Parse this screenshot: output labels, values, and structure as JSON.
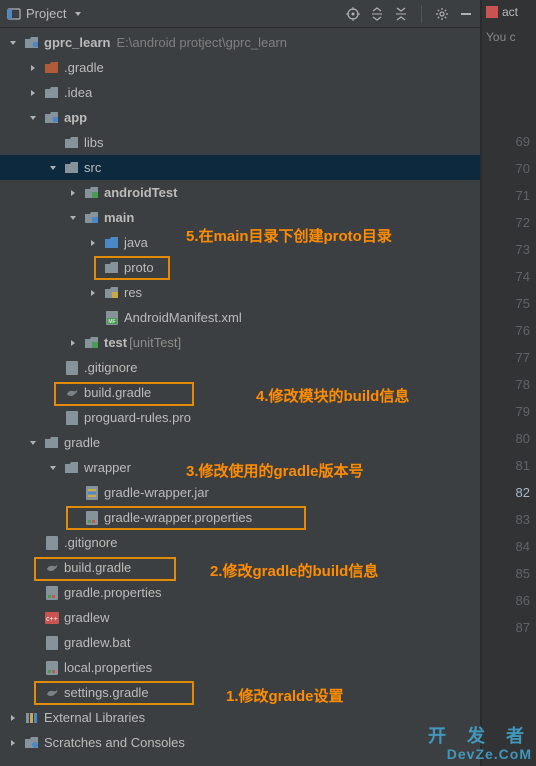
{
  "toolbar": {
    "view_label": "Project"
  },
  "right_panel": {
    "tab_label": "act",
    "hint": "You c"
  },
  "gutter": [
    "69",
    "70",
    "71",
    "72",
    "73",
    "74",
    "75",
    "76",
    "77",
    "78",
    "79",
    "80",
    "81",
    "82",
    "83",
    "84",
    "85",
    "86",
    "87"
  ],
  "gutter_active": "82",
  "root": {
    "name": "gprc_learn",
    "path": "E:\\android protject\\gprc_learn"
  },
  "nodes": {
    "gradle_dir": ".gradle",
    "idea": ".idea",
    "app": "app",
    "libs": "libs",
    "src": "src",
    "androidTest": "androidTest",
    "main": "main",
    "java": "java",
    "proto": "proto",
    "res": "res",
    "manifest": "AndroidManifest.xml",
    "test": "test",
    "test_suffix": " [unitTest]",
    "gitignore": ".gitignore",
    "build_gradle": "build.gradle",
    "proguard": "proguard-rules.pro",
    "gradle": "gradle",
    "wrapper": "wrapper",
    "wrapper_jar": "gradle-wrapper.jar",
    "wrapper_props": "gradle-wrapper.properties",
    "gradle_props": "gradle.properties",
    "gradlew": "gradlew",
    "gradlew_bat": "gradlew.bat",
    "local_props": "local.properties",
    "settings_gradle": "settings.gradle",
    "ext_libs": "External Libraries",
    "scratches": "Scratches and Consoles"
  },
  "annotations": {
    "a5": "5.在main目录下创建proto目录",
    "a4": "4.修改模块的build信息",
    "a3": "3.修改使用的gradle版本号",
    "a2": "2.修改gradle的build信息",
    "a1": "1.修改gralde设置"
  },
  "watermark": {
    "line1": "开 发 者",
    "line2": "DevZe.CoM"
  }
}
